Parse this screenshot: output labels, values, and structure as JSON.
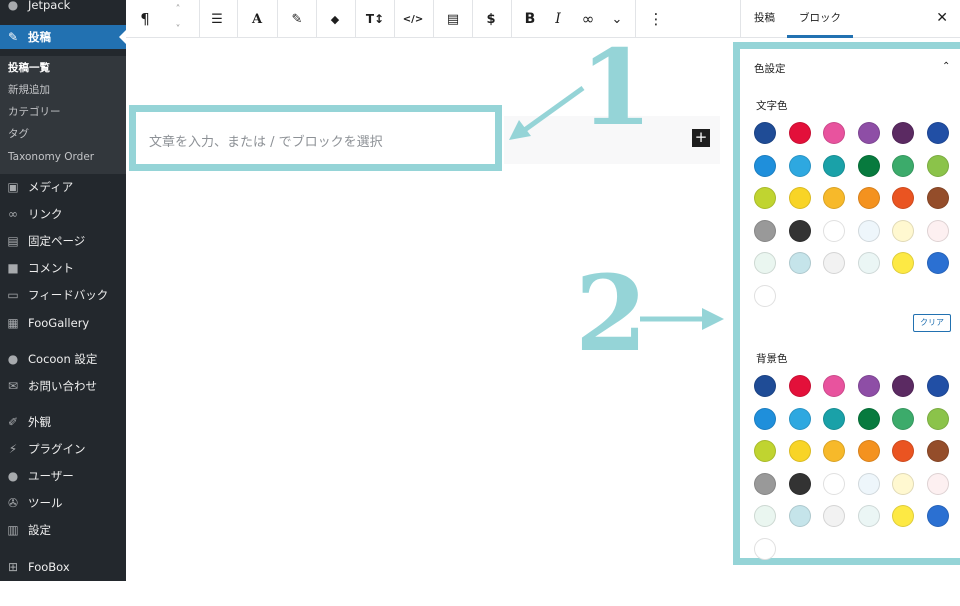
{
  "sidebar": {
    "top_item": {
      "label": "Jetpack",
      "icon": "jetpack-icon"
    },
    "posts": {
      "label": "投稿",
      "icon": "pin-icon"
    },
    "submenu": [
      "投稿一覧",
      "新規追加",
      "カテゴリー",
      "タグ",
      "Taxonomy Order"
    ],
    "items": [
      {
        "label": "メディア",
        "icon": "media-icon"
      },
      {
        "label": "リンク",
        "icon": "link-icon"
      },
      {
        "label": "固定ページ",
        "icon": "page-icon"
      },
      {
        "label": "コメント",
        "icon": "comment-icon"
      },
      {
        "label": "フィードバック",
        "icon": "feedback-icon"
      },
      {
        "label": "FooGallery",
        "icon": "gallery-icon"
      },
      {
        "label": "Cocoon 設定",
        "icon": "cocoon-icon"
      },
      {
        "label": "お問い合わせ",
        "icon": "mail-icon"
      },
      {
        "label": "外観",
        "icon": "brush-icon"
      },
      {
        "label": "プラグイン",
        "icon": "plugin-icon"
      },
      {
        "label": "ユーザー",
        "icon": "user-icon"
      },
      {
        "label": "ツール",
        "icon": "wrench-icon"
      },
      {
        "label": "設定",
        "icon": "settings-icon"
      },
      {
        "label": "FooBox",
        "icon": "foobox-icon"
      }
    ]
  },
  "toolbar": {
    "paragraph": "¶",
    "up": "˄",
    "down": "˅",
    "align": "☰",
    "font": "A",
    "marker": "✎",
    "tag": "◆",
    "size": "T↕",
    "code": "</>",
    "doc": "▤",
    "dollar": "$",
    "bold": "B",
    "italic": "I",
    "link": "∞",
    "more": "⌄",
    "options": "⋮"
  },
  "panel": {
    "tab_post": "投稿",
    "tab_block": "ブロック",
    "close": "✕",
    "section_title": "色設定",
    "chevron": "⌃",
    "text_color_label": "文字色",
    "bg_color_label": "背景色",
    "clear_label": "クリア",
    "palette": [
      "#1f4c96",
      "#e3103a",
      "#e8539e",
      "#8e4ea6",
      "#5b2a62",
      "#214fa5",
      "#1f8fdb",
      "#2ea8e0",
      "#1aa1a8",
      "#077a3e",
      "#3cab6b",
      "#8bc34a",
      "#c0d430",
      "#f8d426",
      "#f7b92a",
      "#f4921f",
      "#ea5421",
      "#944d2a",
      "#999999",
      "#333333",
      "#ffffff",
      "#eef6fb",
      "#fff8d0",
      "#fdf0f1",
      "#eaf6f0",
      "#c5e4ea",
      "#f2f2f2",
      "#ebf6f5",
      "#fde944",
      "#2b70d2",
      "#ffffff"
    ]
  },
  "editor": {
    "placeholder": "文章を入力、または / でブロックを選択",
    "add_block": "+"
  },
  "annotations": {
    "one": "1",
    "two": "2"
  }
}
